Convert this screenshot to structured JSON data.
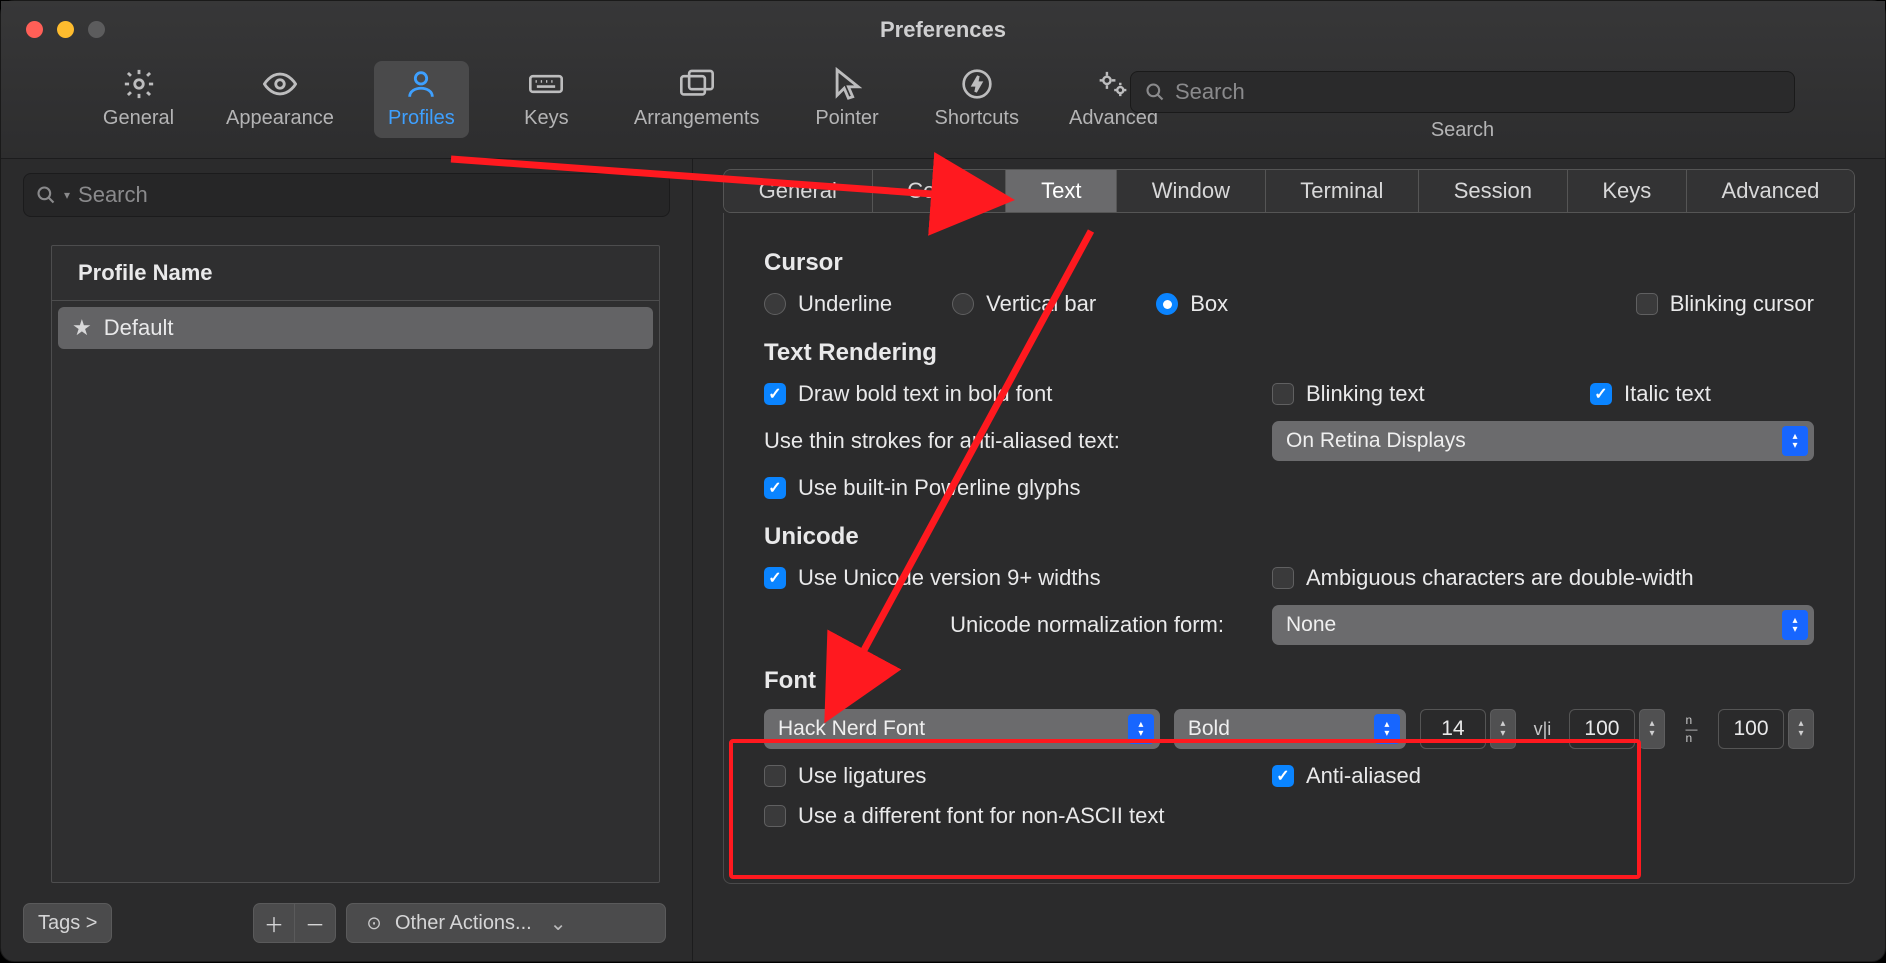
{
  "window": {
    "title": "Preferences"
  },
  "toolbar": {
    "items": [
      {
        "label": "General"
      },
      {
        "label": "Appearance"
      },
      {
        "label": "Profiles"
      },
      {
        "label": "Keys"
      },
      {
        "label": "Arrangements"
      },
      {
        "label": "Pointer"
      },
      {
        "label": "Shortcuts"
      },
      {
        "label": "Advanced"
      }
    ],
    "active_index": 2,
    "search_placeholder": "Search",
    "search_caption": "Search"
  },
  "sidebar": {
    "search_placeholder": "Search",
    "header": "Profile Name",
    "profiles": [
      {
        "name": "Default",
        "starred": true
      }
    ],
    "tags_button": "Tags >",
    "other_actions": "Other Actions..."
  },
  "profile_tabs": {
    "items": [
      "General",
      "Colors",
      "Text",
      "Window",
      "Terminal",
      "Session",
      "Keys",
      "Advanced"
    ],
    "active_index": 2
  },
  "text_panel": {
    "cursor": {
      "title": "Cursor",
      "options": [
        "Underline",
        "Vertical bar",
        "Box"
      ],
      "selected_index": 2,
      "blinking_label": "Blinking cursor",
      "blinking_checked": false
    },
    "rendering": {
      "title": "Text Rendering",
      "bold_label": "Draw bold text in bold font",
      "bold_checked": true,
      "blink_label": "Blinking text",
      "blink_checked": false,
      "italic_label": "Italic text",
      "italic_checked": true,
      "thin_label": "Use thin strokes for anti-aliased text:",
      "thin_value": "On Retina Displays",
      "powerline_label": "Use built-in Powerline glyphs",
      "powerline_checked": true
    },
    "unicode": {
      "title": "Unicode",
      "v9_label": "Use Unicode version 9+ widths",
      "v9_checked": true,
      "ambig_label": "Ambiguous characters are double-width",
      "ambig_checked": false,
      "norm_label": "Unicode normalization form:",
      "norm_value": "None"
    },
    "font": {
      "title": "Font",
      "family": "Hack Nerd Font",
      "weight": "Bold",
      "size": "14",
      "h_spacing": "100",
      "v_spacing": "100",
      "ligatures_label": "Use ligatures",
      "ligatures_checked": false,
      "aa_label": "Anti-aliased",
      "aa_checked": true,
      "nonascii_label": "Use a different font for non-ASCII text",
      "nonascii_checked": false
    }
  }
}
